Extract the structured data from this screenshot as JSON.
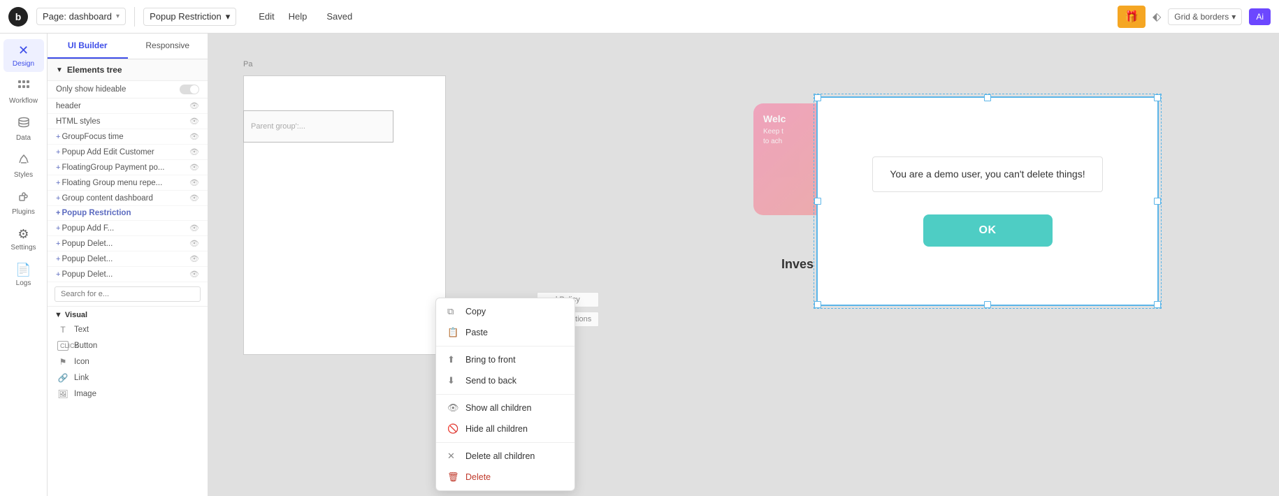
{
  "topbar": {
    "logo": "b",
    "page_label": "Page: dashboard",
    "page_chevron": "▾",
    "popup_label": "Popup Restriction",
    "popup_chevron": "▾",
    "edit_label": "Edit",
    "help_label": "Help",
    "saved_label": "Saved",
    "gift_icon": "🎁",
    "grid_label": "Grid & borders",
    "grid_chevron": "▾",
    "ai_label": "Ai"
  },
  "sidebar": {
    "items": [
      {
        "id": "design",
        "icon": "✕",
        "label": "Design",
        "active": true
      },
      {
        "id": "workflow",
        "icon": "⋮⋮",
        "label": "Workflow"
      },
      {
        "id": "data",
        "icon": "🗄",
        "label": "Data"
      },
      {
        "id": "styles",
        "icon": "✏",
        "label": "Styles"
      },
      {
        "id": "plugins",
        "icon": "🔌",
        "label": "Plugins"
      },
      {
        "id": "settings",
        "icon": "⚙",
        "label": "Settings"
      },
      {
        "id": "logs",
        "icon": "📄",
        "label": "Logs"
      }
    ]
  },
  "panel": {
    "tab_ui_builder": "UI Builder",
    "tab_responsive": "Responsive",
    "section_title": "Elements tree",
    "only_show_hideable": "Only show hideable",
    "tree_items": [
      {
        "label": "header",
        "has_eye": true,
        "prefix": ""
      },
      {
        "label": "HTML styles",
        "has_eye": true,
        "prefix": ""
      },
      {
        "label": "GroupFocus time",
        "has_eye": true,
        "prefix": "+"
      },
      {
        "label": "Popup Add Edit Customer",
        "has_eye": true,
        "prefix": "+"
      },
      {
        "label": "FloatingGroup Payment po...",
        "has_eye": true,
        "prefix": "+"
      },
      {
        "label": "Floating Group menu repe...",
        "has_eye": true,
        "prefix": "+"
      },
      {
        "label": "Group content dashboard",
        "has_eye": true,
        "prefix": "+"
      },
      {
        "label": "Popup Restriction",
        "has_eye": false,
        "prefix": "+",
        "active": true
      },
      {
        "label": "Popup Add F...",
        "has_eye": true,
        "prefix": "+"
      },
      {
        "label": "Popup Delet...",
        "has_eye": true,
        "prefix": "+"
      },
      {
        "label": "Popup Delet...",
        "has_eye": true,
        "prefix": "+"
      },
      {
        "label": "Popup Delet...",
        "has_eye": true,
        "prefix": "+"
      }
    ],
    "search_placeholder": "Search for e...",
    "visual_section_title": "Visual",
    "visual_items": [
      {
        "icon": "T",
        "label": "Text"
      },
      {
        "icon": "▣",
        "label": "Button"
      },
      {
        "icon": "⚑",
        "label": "Icon"
      },
      {
        "icon": "🔗",
        "label": "Link"
      },
      {
        "icon": "🖼",
        "label": "Image"
      }
    ]
  },
  "context_menu": {
    "items": [
      {
        "icon": "⧉",
        "label": "Copy",
        "divider_after": false
      },
      {
        "icon": "📋",
        "label": "Paste",
        "divider_after": true
      },
      {
        "icon": "⬆",
        "label": "Bring to front",
        "divider_after": false
      },
      {
        "icon": "⬇",
        "label": "Send to back",
        "divider_after": true
      },
      {
        "icon": "👁",
        "label": "Show all children",
        "divider_after": false
      },
      {
        "icon": "🚫",
        "label": "Hide all children",
        "divider_after": true
      },
      {
        "icon": "✕",
        "label": "Delete all children",
        "divider_after": false
      },
      {
        "icon": "🗑",
        "label": "Delete",
        "divider_after": false,
        "danger": true
      }
    ]
  },
  "canvas": {
    "page_label": "Pa",
    "parent_group_label": "Parent group':...",
    "welcome_title": "Welc",
    "welcome_sub": "Keep t\nto ach",
    "invest_label": "Inves",
    "policy_links": [
      "and Policy",
      "nd Conditions"
    ]
  },
  "modal": {
    "message": "You are a demo user, you can't delete things!",
    "ok_label": "OK"
  }
}
